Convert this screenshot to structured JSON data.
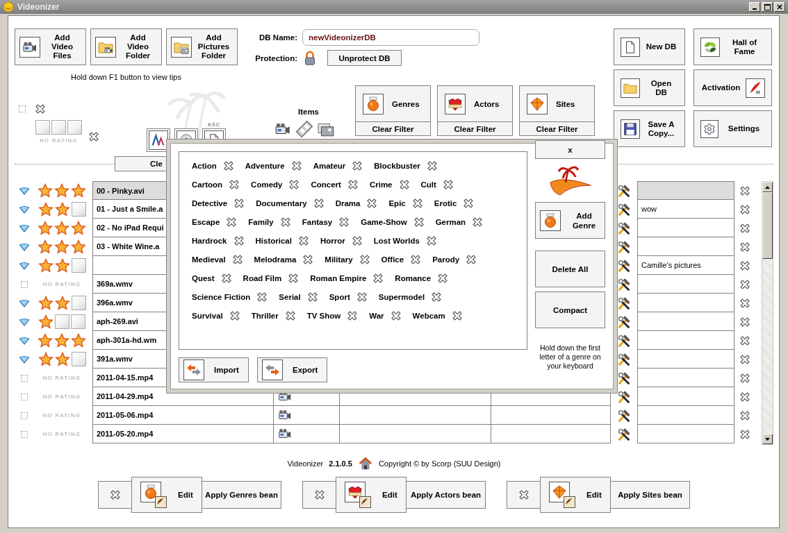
{
  "window": {
    "title": "Videonizer"
  },
  "toolbar": {
    "buttons": [
      {
        "label": "Add Video Files",
        "kind": "video"
      },
      {
        "label": "Add Video Folder",
        "kind": "video_folder"
      },
      {
        "label": "Add Pictures Folder",
        "kind": "picture_folder"
      }
    ],
    "tip": "Hold down F1 button to view tips"
  },
  "database": {
    "name_label": "DB Name:",
    "name_value": "newVideonizerDB",
    "protection_label": "Protection:",
    "protect_button": "Unprotect DB"
  },
  "db_buttons": [
    {
      "label": "New DB",
      "kind": "new"
    },
    {
      "label": "Hall of Fame",
      "kind": "fame"
    },
    {
      "label": "Open DB",
      "kind": "open"
    },
    {
      "label": "Activation",
      "kind": "activation"
    },
    {
      "label": "Save A Copy...",
      "kind": "save"
    },
    {
      "label": "Settings",
      "kind": "settings"
    }
  ],
  "rating_filter": {
    "checked": false,
    "stars": 0,
    "rating_label": "NO RATING"
  },
  "sort": {
    "order_label": "ASC"
  },
  "items": {
    "label": "Items"
  },
  "filters": [
    {
      "label": "Genres",
      "kind": "genres",
      "clear": "Clear Filter"
    },
    {
      "label": "Actors",
      "kind": "actors",
      "clear": "Clear Filter"
    },
    {
      "label": "Sites",
      "kind": "sites",
      "clear": "Clear Filter"
    }
  ],
  "clear_button": "Cle",
  "files": [
    {
      "checked": true,
      "stars": 3,
      "name": "00 - Pinky.avi",
      "selected": true
    },
    {
      "checked": true,
      "stars": 2,
      "name": "01 - Just a Smile.a",
      "note": "wow",
      "selected": false
    },
    {
      "checked": true,
      "stars": 3,
      "name": "02 - No iPad Requi",
      "selected": false
    },
    {
      "checked": true,
      "stars": 3,
      "name": "03 - White Wine.a",
      "selected": false
    },
    {
      "checked": true,
      "stars": 2,
      "note": "Camille's pictures",
      "selected": false
    },
    {
      "checked": false,
      "rating_label": "NO RATING",
      "name": "369a.wmv",
      "selected": false
    },
    {
      "checked": true,
      "stars": 2,
      "name": "396a.wmv",
      "selected": false
    },
    {
      "checked": true,
      "stars": 1,
      "name": "aph-269.avi",
      "selected": false
    },
    {
      "checked": true,
      "stars": 3,
      "name": "aph-301a-hd.wm",
      "selected": false
    },
    {
      "checked": true,
      "stars": 2,
      "name": "391a.wmv",
      "selected": false
    },
    {
      "checked": false,
      "rating_label": "NO RATING",
      "name": "2011-04-15.mp4",
      "selected": false
    },
    {
      "checked": false,
      "rating_label": "NO RATING",
      "name": "2011-04-29.mp4",
      "video": true,
      "selected": false
    },
    {
      "checked": false,
      "rating_label": "NO RATING",
      "name": "2011-05-06.mp4",
      "video": true,
      "selected": false
    },
    {
      "checked": false,
      "rating_label": "NO RATING",
      "name": "2011-05-20.mp4",
      "video": true,
      "selected": false
    }
  ],
  "footer": {
    "app": "Videonizer",
    "version": "2.1.0.5",
    "copyright": "Copyright © by Scorp (SUU Design)"
  },
  "beans": [
    {
      "kind": "genres",
      "edit": "Edit",
      "apply": "Apply Genres bean"
    },
    {
      "kind": "actors",
      "edit": "Edit",
      "apply": "Apply Actors bean"
    },
    {
      "kind": "sites",
      "edit": "Edit",
      "apply": "Apply Sites bean"
    }
  ],
  "genre_dialog": {
    "close": "x",
    "genre_rows": [
      [
        "Action",
        "Adventure",
        "Amateur",
        "Blockbuster"
      ],
      [
        "Cartoon",
        "Comedy",
        "Concert",
        "Crime",
        "Cult"
      ],
      [
        "Detective",
        "Documentary",
        "Drama",
        "Epic",
        "Erotic"
      ],
      [
        "Escape",
        "Family",
        "Fantasy",
        "Game-Show",
        "German"
      ],
      [
        "Hardrock",
        "Historical",
        "Horror",
        "Lost Worlds"
      ],
      [
        "Medieval",
        "Melodrama",
        "Military",
        "Office",
        "Parody"
      ],
      [
        "Quest",
        "Road Film",
        "Roman Empire",
        "Romance"
      ],
      [
        "Science Fiction",
        "Serial",
        "Sport",
        "Supermodel"
      ],
      [
        "Survival",
        "Thriller",
        "TV Show",
        "War",
        "Webcam"
      ]
    ],
    "add": "Add Genre",
    "delete_all": "Delete All",
    "compact": "Compact",
    "hint": "Hold down the first letter of a genre on your keyboard",
    "import": "Import",
    "export": "Export"
  }
}
